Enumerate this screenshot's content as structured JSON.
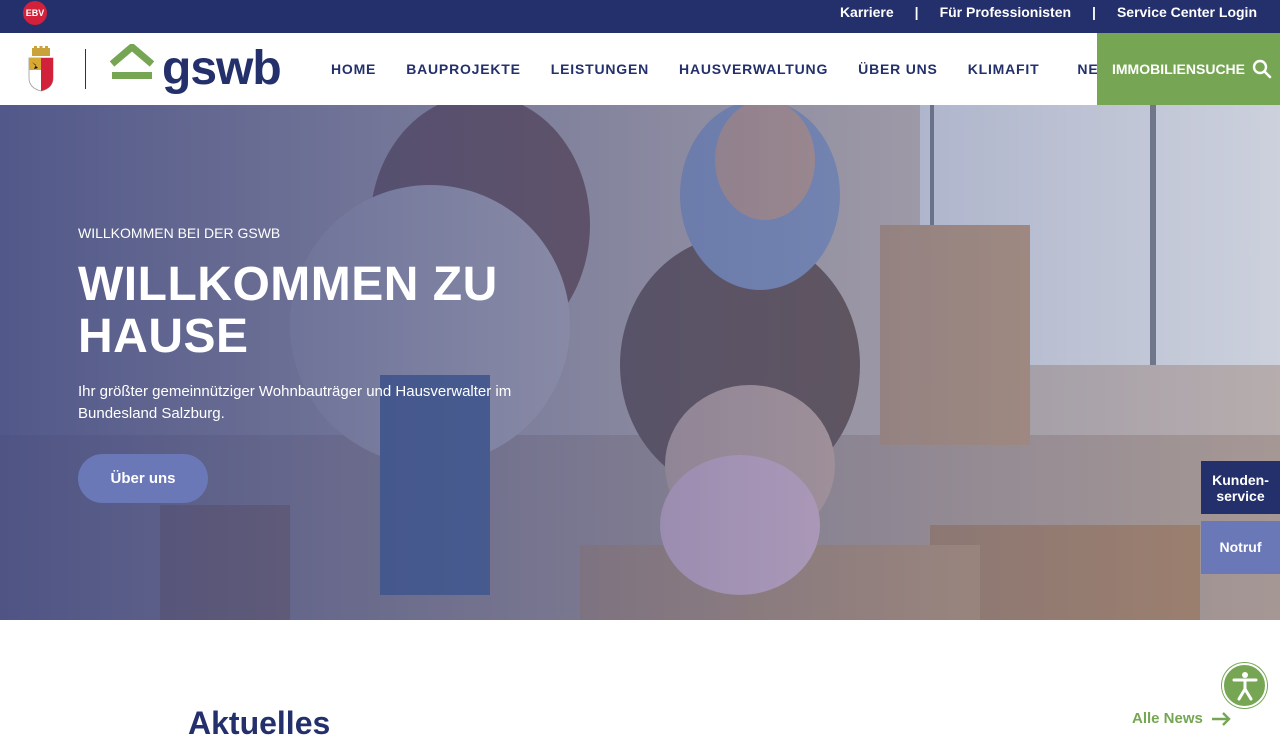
{
  "topbar": {
    "logo_text": "EBV",
    "links": [
      "Karriere",
      "Für Professionisten",
      "Service Center Login"
    ],
    "separator": "|"
  },
  "header": {
    "logo_text": "gswb",
    "nav": [
      "HOME",
      "BAUPROJEKTE",
      "LEISTUNGEN",
      "HAUSVERWALTUNG",
      "ÜBER UNS",
      "KLIMAFIT",
      "NEWS"
    ],
    "search_label": "IMMOBILIENSUCHE"
  },
  "hero": {
    "eyebrow": "WILLKOMMEN BEI DER GSWB",
    "headline": "WILLKOMMEN ZU HAUSE",
    "lead": "Ihr größter gemeinnütziger Wohnbauträger und Hausverwalter im Bundesland Salzburg.",
    "cta": "Über uns"
  },
  "side": {
    "kundenservice": "Kunden-service",
    "notruf": "Notruf"
  },
  "news": {
    "title": "Aktuelles",
    "all_link": "Alle News"
  },
  "colors": {
    "navy": "#24306b",
    "green": "#76a653",
    "blue_light": "#6a78b8",
    "ebv_red": "#d2213a"
  },
  "icons": {
    "search": "search-icon",
    "arrow": "arrow-right-icon",
    "accessibility": "accessibility-icon"
  }
}
